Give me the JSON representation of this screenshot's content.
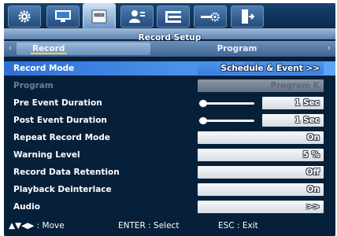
{
  "header": {
    "title": "Record Setup",
    "icon_tabs": [
      {
        "icon": "gear-icon"
      },
      {
        "icon": "monitor-icon"
      },
      {
        "icon": "hdd-icon",
        "label": "HDD",
        "active": true
      },
      {
        "icon": "user-icon"
      },
      {
        "icon": "network-icon"
      },
      {
        "icon": "settings-slider-icon"
      },
      {
        "icon": "exit-icon"
      }
    ]
  },
  "subtabs": {
    "left_arrow": "‹",
    "right_arrow": "›",
    "record": "Record",
    "program": "Program"
  },
  "settings": {
    "record_mode": {
      "label": "Record Mode",
      "value": "Schedule & Event >>"
    },
    "program": {
      "label": "Program",
      "value": "Program K"
    },
    "pre_event": {
      "label": "Pre Event Duration",
      "value": "1 Sec",
      "slider_level": 0
    },
    "post_event": {
      "label": "Post Event Duration",
      "value": "1 Sec",
      "slider_level": 0
    },
    "repeat": {
      "label": "Repeat Record Mode",
      "value": "On"
    },
    "warning": {
      "label": "Warning Level",
      "value": "5 %"
    },
    "retention": {
      "label": "Record Data Retention",
      "value": "Off"
    },
    "deinterlace": {
      "label": "Playback Deinterlace",
      "value": "On"
    },
    "audio": {
      "label": "Audio",
      "value": ">>"
    }
  },
  "footer": {
    "move": "▲▼◀▶ : Move",
    "enter": "ENTER : Select",
    "esc": "ESC : Exit"
  },
  "colors": {
    "background": "#06203a",
    "selected_row": "#3a82e4",
    "title_bar": "#7d9fc7"
  }
}
